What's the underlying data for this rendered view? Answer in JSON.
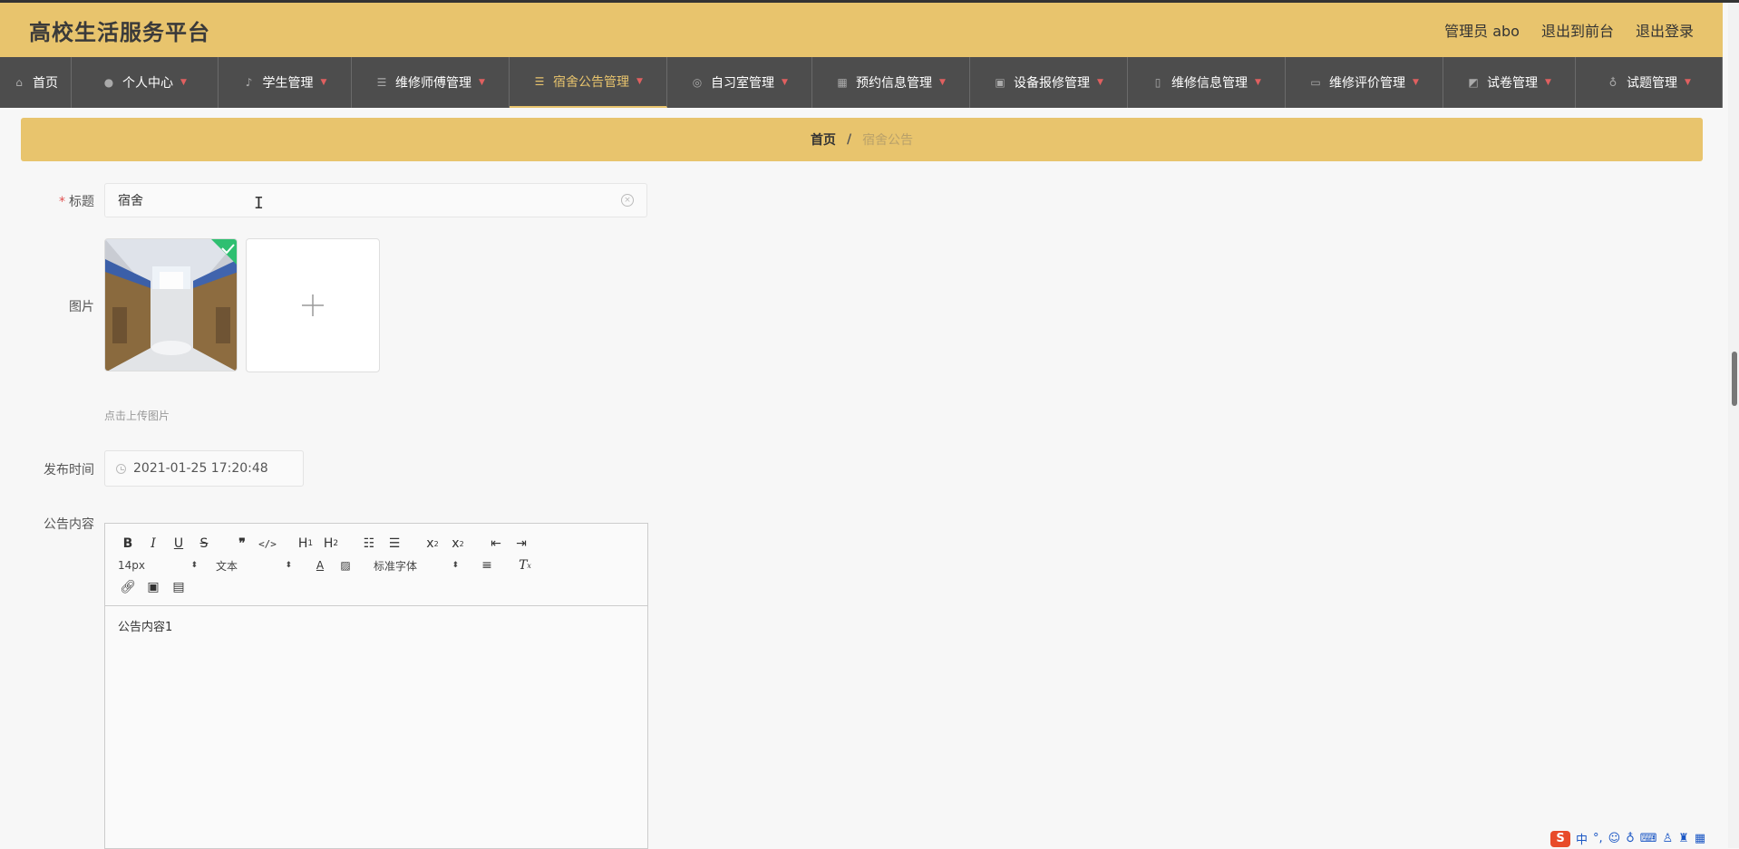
{
  "header": {
    "brand": "高校生活服务平台",
    "user_label": "管理员 abo",
    "front_link": "退出到前台",
    "logout_link": "退出登录"
  },
  "nav": {
    "items": [
      {
        "label": "首页",
        "icon": "home-icon",
        "has_caret": false
      },
      {
        "label": "个人中心",
        "icon": "user-icon",
        "has_caret": true
      },
      {
        "label": "学生管理",
        "icon": "bell-icon",
        "has_caret": true
      },
      {
        "label": "维修师傅管理",
        "icon": "list-icon",
        "has_caret": true
      },
      {
        "label": "宿舍公告管理",
        "icon": "list-icon",
        "has_caret": true
      },
      {
        "label": "自习室管理",
        "icon": "compass-icon",
        "has_caret": true
      },
      {
        "label": "预约信息管理",
        "icon": "grid-icon",
        "has_caret": true
      },
      {
        "label": "设备报修管理",
        "icon": "clipboard-icon",
        "has_caret": true
      },
      {
        "label": "维修信息管理",
        "icon": "phone-icon",
        "has_caret": true
      },
      {
        "label": "维修评价管理",
        "icon": "monitor-icon",
        "has_caret": true
      },
      {
        "label": "试卷管理",
        "icon": "chart-icon",
        "has_caret": true
      },
      {
        "label": "试题管理",
        "icon": "mic-icon",
        "has_caret": true
      }
    ],
    "active_index": 4
  },
  "breadcrumb": {
    "home": "首页",
    "separator": "/",
    "current": "宿舍公告"
  },
  "form": {
    "title_label": "标题",
    "title_value": "宿舍",
    "image_label": "图片",
    "upload_hint": "点击上传图片",
    "date_label": "发布时间",
    "date_value": "2021-01-25 17:20:48",
    "content_label": "公告内容"
  },
  "editor": {
    "font_size": "14px",
    "heading": "文本",
    "font_family": "标准字体",
    "content": "公告内容1"
  },
  "ime": {
    "lang": "中",
    "punct": "°,"
  },
  "colors": {
    "accent": "#e8c46d",
    "nav_bg": "#4d4d4d",
    "success": "#2fbf71",
    "required": "#e05050"
  }
}
